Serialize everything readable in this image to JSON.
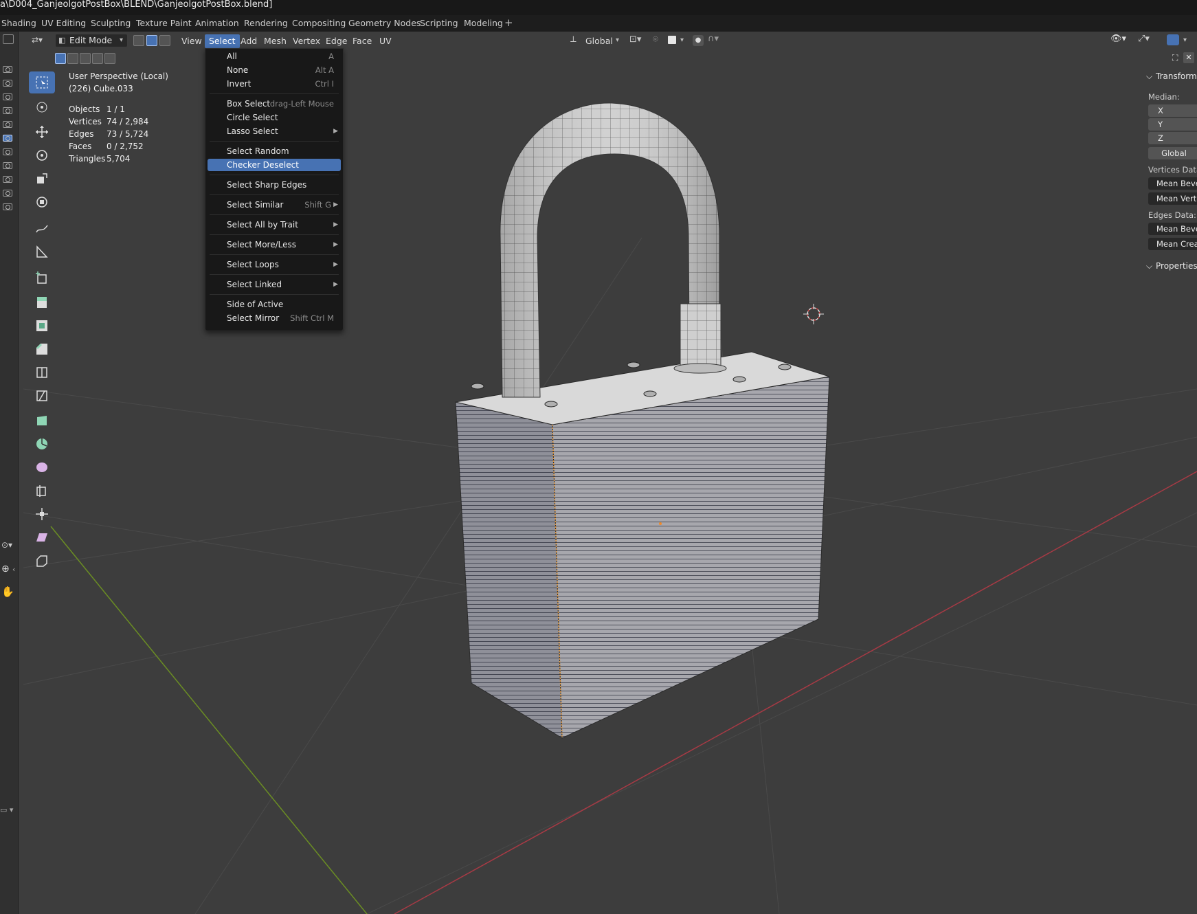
{
  "window": {
    "title": "a\\D004_GanjeolgotPostBox\\BLEND\\GanjeolgotPostBox.blend]"
  },
  "workspaces": [
    "Shading",
    "UV Editing",
    "Sculpting",
    "Texture Paint",
    "Animation",
    "Rendering",
    "Compositing",
    "Geometry Nodes",
    "Scripting",
    "Modeling"
  ],
  "workspace_add": "+",
  "header": {
    "mode": "Edit Mode",
    "menus": [
      "View",
      "Select",
      "Add",
      "Mesh",
      "Vertex",
      "Edge",
      "Face",
      "UV"
    ],
    "active_menu": "Select",
    "orientation": "Global"
  },
  "overlay_info": {
    "perspective": "User Perspective (Local)",
    "object": "(226) Cube.033",
    "stats": [
      {
        "key": "Objects",
        "value": "1 / 1"
      },
      {
        "key": "Vertices",
        "value": "74 / 2,984"
      },
      {
        "key": "Edges",
        "value": "73 / 5,724"
      },
      {
        "key": "Faces",
        "value": "0 / 2,752"
      },
      {
        "key": "Triangles",
        "value": "5,704"
      }
    ]
  },
  "select_menu": [
    {
      "label": "All",
      "shortcut": "A"
    },
    {
      "label": "None",
      "shortcut": "Alt A"
    },
    {
      "label": "Invert",
      "shortcut": "Ctrl I"
    },
    {
      "label": "Box Select",
      "shortcut": "drag-Left Mouse"
    },
    {
      "label": "Circle Select",
      "shortcut": ""
    },
    {
      "label": "Lasso Select",
      "shortcut": "",
      "submenu": true
    },
    {
      "label": "Select Random",
      "shortcut": ""
    },
    {
      "label": "Checker Deselect",
      "shortcut": "",
      "highlighted": true
    },
    {
      "label": "Select Sharp Edges",
      "shortcut": ""
    },
    {
      "label": "Select Similar",
      "shortcut": "Shift G",
      "submenu": true
    },
    {
      "label": "Select All by Trait",
      "shortcut": "",
      "submenu": true
    },
    {
      "label": "Select More/Less",
      "shortcut": "",
      "submenu": true
    },
    {
      "label": "Select Loops",
      "shortcut": "",
      "submenu": true
    },
    {
      "label": "Select Linked",
      "shortcut": "",
      "submenu": true
    },
    {
      "label": "Side of Active",
      "shortcut": ""
    },
    {
      "label": "Select Mirror",
      "shortcut": "Shift Ctrl M"
    }
  ],
  "side_panel": {
    "transform_title": "Transform",
    "median_label": "Median:",
    "axes": [
      "X",
      "Y",
      "Z"
    ],
    "space": "Global",
    "vertices_data_label": "Vertices Data:",
    "vertices_fields": [
      "Mean Bevel",
      "Mean Verte"
    ],
    "edges_data_label": "Edges Data:",
    "edges_fields": [
      "Mean Bevel",
      "Mean Creas"
    ],
    "properties_title": "Properties"
  },
  "colors": {
    "accent": "#4772b3",
    "viewport_bg": "#3d3d3d",
    "menu_bg": "#181818",
    "x_axis": "#a83a45",
    "y_axis": "#6b8e23"
  }
}
